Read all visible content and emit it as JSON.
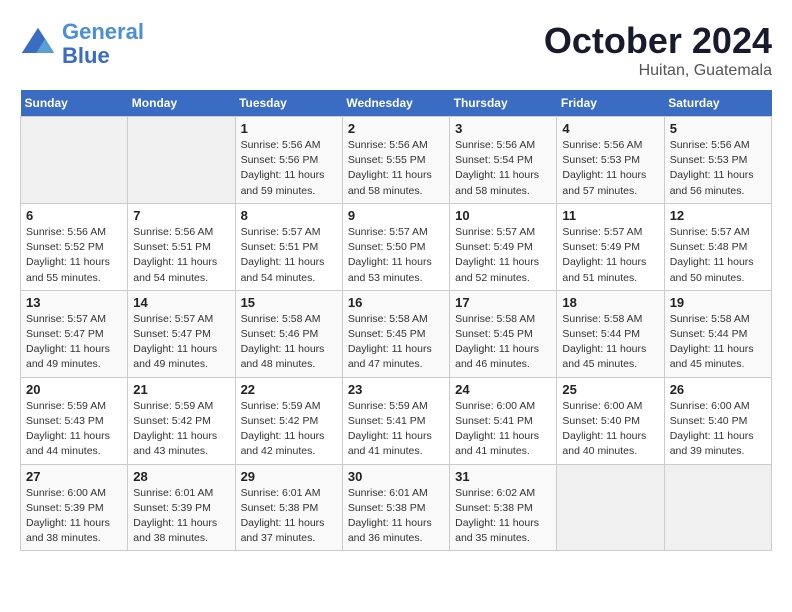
{
  "header": {
    "logo_line1": "General",
    "logo_line2": "Blue",
    "month": "October 2024",
    "location": "Huitan, Guatemala"
  },
  "weekdays": [
    "Sunday",
    "Monday",
    "Tuesday",
    "Wednesday",
    "Thursday",
    "Friday",
    "Saturday"
  ],
  "weeks": [
    [
      {
        "day": "",
        "empty": true
      },
      {
        "day": "",
        "empty": true
      },
      {
        "day": "1",
        "text": "Sunrise: 5:56 AM\nSunset: 5:56 PM\nDaylight: 11 hours\nand 59 minutes."
      },
      {
        "day": "2",
        "text": "Sunrise: 5:56 AM\nSunset: 5:55 PM\nDaylight: 11 hours\nand 58 minutes."
      },
      {
        "day": "3",
        "text": "Sunrise: 5:56 AM\nSunset: 5:54 PM\nDaylight: 11 hours\nand 58 minutes."
      },
      {
        "day": "4",
        "text": "Sunrise: 5:56 AM\nSunset: 5:53 PM\nDaylight: 11 hours\nand 57 minutes."
      },
      {
        "day": "5",
        "text": "Sunrise: 5:56 AM\nSunset: 5:53 PM\nDaylight: 11 hours\nand 56 minutes."
      }
    ],
    [
      {
        "day": "6",
        "text": "Sunrise: 5:56 AM\nSunset: 5:52 PM\nDaylight: 11 hours\nand 55 minutes."
      },
      {
        "day": "7",
        "text": "Sunrise: 5:56 AM\nSunset: 5:51 PM\nDaylight: 11 hours\nand 54 minutes."
      },
      {
        "day": "8",
        "text": "Sunrise: 5:57 AM\nSunset: 5:51 PM\nDaylight: 11 hours\nand 54 minutes."
      },
      {
        "day": "9",
        "text": "Sunrise: 5:57 AM\nSunset: 5:50 PM\nDaylight: 11 hours\nand 53 minutes."
      },
      {
        "day": "10",
        "text": "Sunrise: 5:57 AM\nSunset: 5:49 PM\nDaylight: 11 hours\nand 52 minutes."
      },
      {
        "day": "11",
        "text": "Sunrise: 5:57 AM\nSunset: 5:49 PM\nDaylight: 11 hours\nand 51 minutes."
      },
      {
        "day": "12",
        "text": "Sunrise: 5:57 AM\nSunset: 5:48 PM\nDaylight: 11 hours\nand 50 minutes."
      }
    ],
    [
      {
        "day": "13",
        "text": "Sunrise: 5:57 AM\nSunset: 5:47 PM\nDaylight: 11 hours\nand 49 minutes."
      },
      {
        "day": "14",
        "text": "Sunrise: 5:57 AM\nSunset: 5:47 PM\nDaylight: 11 hours\nand 49 minutes."
      },
      {
        "day": "15",
        "text": "Sunrise: 5:58 AM\nSunset: 5:46 PM\nDaylight: 11 hours\nand 48 minutes."
      },
      {
        "day": "16",
        "text": "Sunrise: 5:58 AM\nSunset: 5:45 PM\nDaylight: 11 hours\nand 47 minutes."
      },
      {
        "day": "17",
        "text": "Sunrise: 5:58 AM\nSunset: 5:45 PM\nDaylight: 11 hours\nand 46 minutes."
      },
      {
        "day": "18",
        "text": "Sunrise: 5:58 AM\nSunset: 5:44 PM\nDaylight: 11 hours\nand 45 minutes."
      },
      {
        "day": "19",
        "text": "Sunrise: 5:58 AM\nSunset: 5:44 PM\nDaylight: 11 hours\nand 45 minutes."
      }
    ],
    [
      {
        "day": "20",
        "text": "Sunrise: 5:59 AM\nSunset: 5:43 PM\nDaylight: 11 hours\nand 44 minutes."
      },
      {
        "day": "21",
        "text": "Sunrise: 5:59 AM\nSunset: 5:42 PM\nDaylight: 11 hours\nand 43 minutes."
      },
      {
        "day": "22",
        "text": "Sunrise: 5:59 AM\nSunset: 5:42 PM\nDaylight: 11 hours\nand 42 minutes."
      },
      {
        "day": "23",
        "text": "Sunrise: 5:59 AM\nSunset: 5:41 PM\nDaylight: 11 hours\nand 41 minutes."
      },
      {
        "day": "24",
        "text": "Sunrise: 6:00 AM\nSunset: 5:41 PM\nDaylight: 11 hours\nand 41 minutes."
      },
      {
        "day": "25",
        "text": "Sunrise: 6:00 AM\nSunset: 5:40 PM\nDaylight: 11 hours\nand 40 minutes."
      },
      {
        "day": "26",
        "text": "Sunrise: 6:00 AM\nSunset: 5:40 PM\nDaylight: 11 hours\nand 39 minutes."
      }
    ],
    [
      {
        "day": "27",
        "text": "Sunrise: 6:00 AM\nSunset: 5:39 PM\nDaylight: 11 hours\nand 38 minutes."
      },
      {
        "day": "28",
        "text": "Sunrise: 6:01 AM\nSunset: 5:39 PM\nDaylight: 11 hours\nand 38 minutes."
      },
      {
        "day": "29",
        "text": "Sunrise: 6:01 AM\nSunset: 5:38 PM\nDaylight: 11 hours\nand 37 minutes."
      },
      {
        "day": "30",
        "text": "Sunrise: 6:01 AM\nSunset: 5:38 PM\nDaylight: 11 hours\nand 36 minutes."
      },
      {
        "day": "31",
        "text": "Sunrise: 6:02 AM\nSunset: 5:38 PM\nDaylight: 11 hours\nand 35 minutes."
      },
      {
        "day": "",
        "empty": true
      },
      {
        "day": "",
        "empty": true
      }
    ]
  ]
}
